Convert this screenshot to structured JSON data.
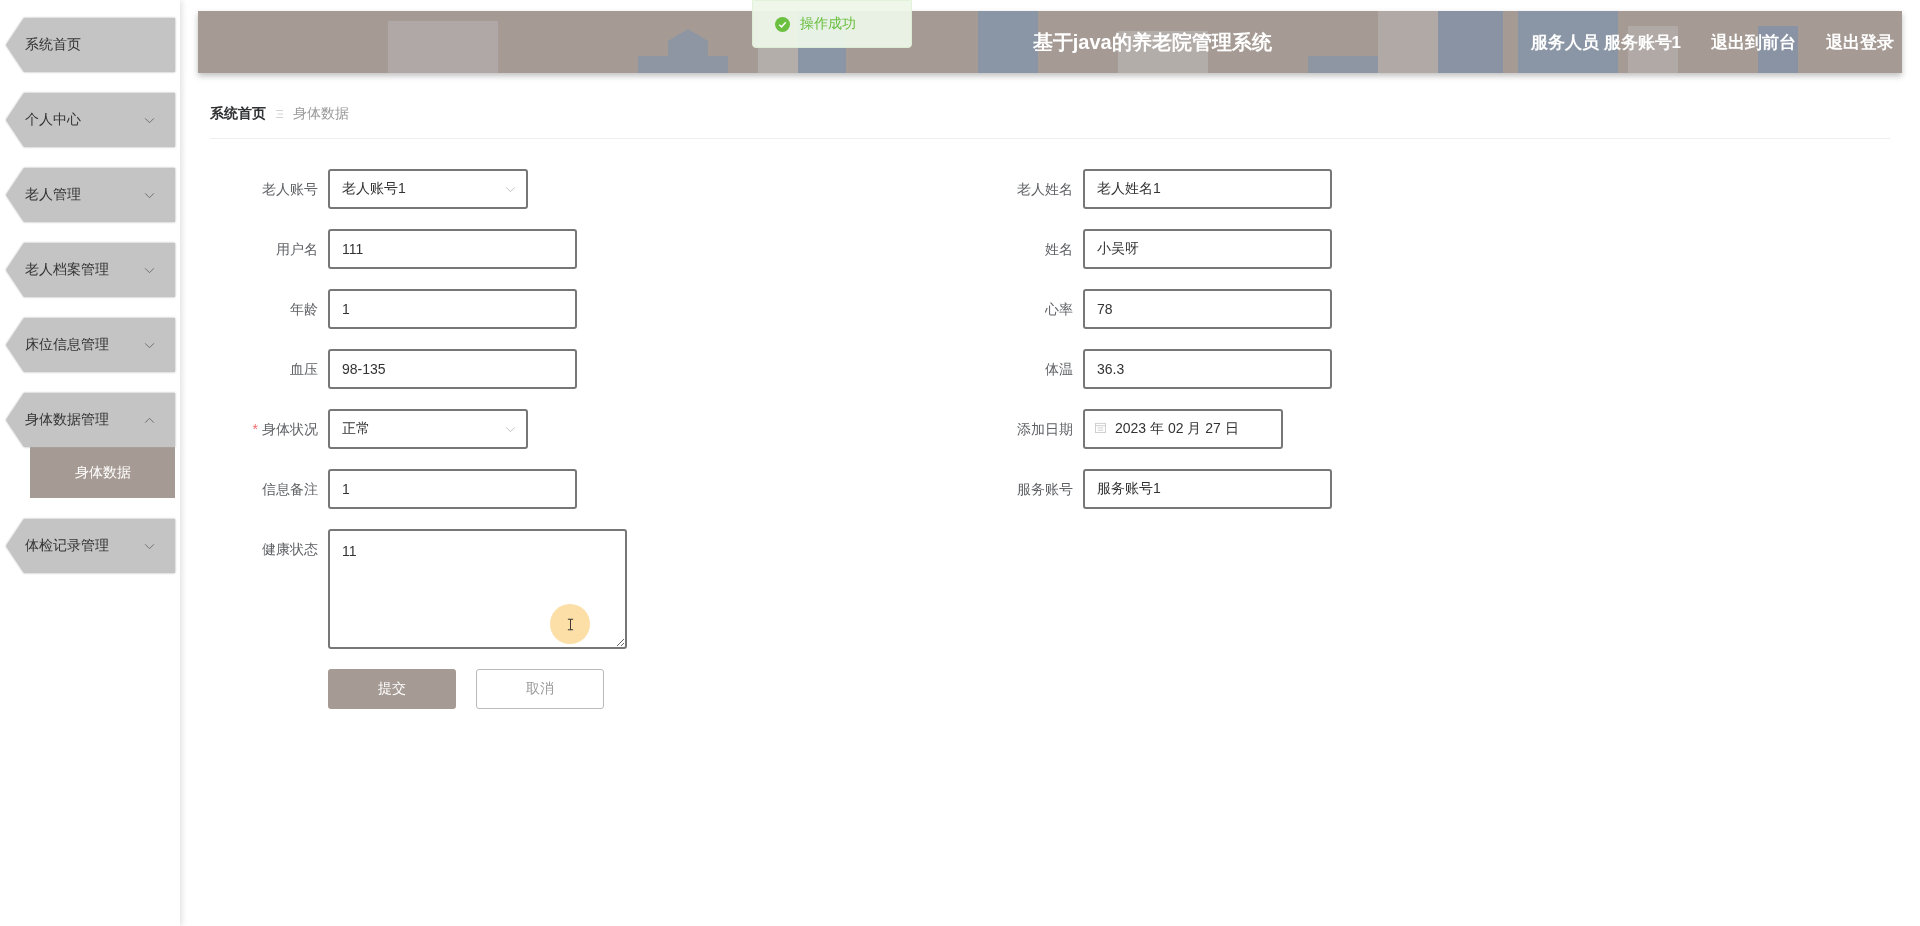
{
  "sidebar": {
    "items": [
      {
        "label": "系统首页",
        "kind": "link"
      },
      {
        "label": "个人中心",
        "kind": "menu",
        "expanded": false
      },
      {
        "label": "老人管理",
        "kind": "menu",
        "expanded": false
      },
      {
        "label": "老人档案管理",
        "kind": "menu",
        "expanded": false
      },
      {
        "label": "床位信息管理",
        "kind": "menu",
        "expanded": false
      },
      {
        "label": "身体数据管理",
        "kind": "menu",
        "expanded": true,
        "children": [
          {
            "label": "身体数据",
            "selected": true
          }
        ]
      },
      {
        "label": "体检记录管理",
        "kind": "menu",
        "expanded": false
      }
    ]
  },
  "header": {
    "title": "基于java的养老院管理系统",
    "user": "服务人员 服务账号1",
    "links": [
      "退出到前台",
      "退出登录"
    ]
  },
  "toast": {
    "message": "操作成功"
  },
  "breadcrumb": [
    {
      "label": "系统首页",
      "current": false
    },
    {
      "label": "身体数据",
      "current": true
    }
  ],
  "form": {
    "left": [
      {
        "label": "老人账号",
        "value": "老人账号1",
        "kind": "select"
      },
      {
        "label": "用户名",
        "value": "111",
        "kind": "input"
      },
      {
        "label": "年龄",
        "value": "1",
        "kind": "input"
      },
      {
        "label": "血压",
        "value": "98-135",
        "kind": "input"
      },
      {
        "label": "身体状况",
        "value": "正常",
        "kind": "select",
        "required_mark": "*"
      },
      {
        "label": "信息备注",
        "value": "1",
        "kind": "input"
      },
      {
        "label": "健康状态",
        "value": "11",
        "kind": "textarea"
      }
    ],
    "right": [
      {
        "label": "老人姓名",
        "value": "老人姓名1",
        "kind": "input"
      },
      {
        "label": "姓名",
        "value": "小吴呀",
        "kind": "input"
      },
      {
        "label": "心率",
        "value": "78",
        "kind": "input"
      },
      {
        "label": "体温",
        "value": "36.3",
        "kind": "input"
      },
      {
        "label": "添加日期",
        "value": "2023 年 02 月 27 日",
        "kind": "date"
      },
      {
        "label": "服务账号",
        "value": "服务账号1",
        "kind": "input"
      }
    ],
    "buttons": [
      {
        "label": "提交",
        "kind": "primary"
      },
      {
        "label": "取消",
        "kind": "secondary"
      }
    ]
  }
}
